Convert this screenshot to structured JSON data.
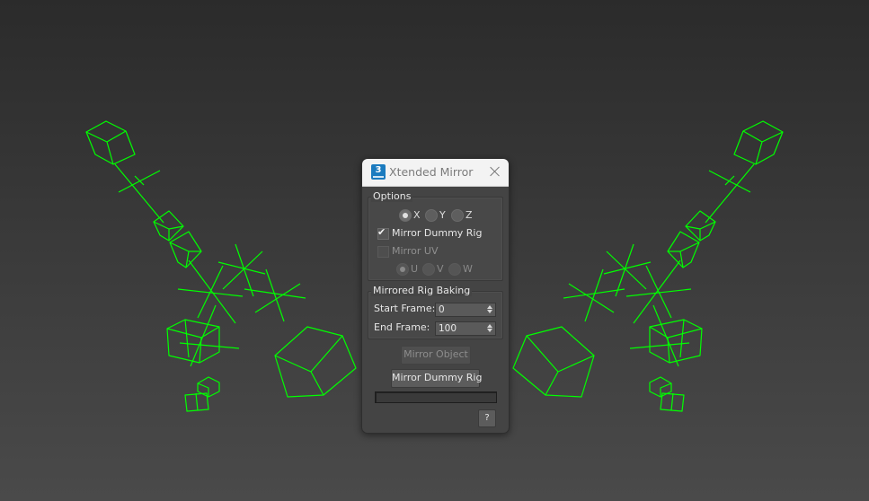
{
  "colors": {
    "wireframe": "#00ff00",
    "accent": "#1b7bbf"
  },
  "dialog": {
    "title": "Xtended Mirror",
    "icon": "3ds-max-app-icon",
    "options": {
      "label": "Options",
      "axis": [
        {
          "label": "X",
          "selected": true
        },
        {
          "label": "Y",
          "selected": false
        },
        {
          "label": "Z",
          "selected": false
        }
      ],
      "mirror_dummy_rig": {
        "label": "Mirror Dummy Rig",
        "checked": true
      },
      "mirror_uv": {
        "label": "Mirror UV",
        "checked": false,
        "enabled": false
      },
      "uv_axis": [
        {
          "label": "U",
          "selected": true
        },
        {
          "label": "V",
          "selected": false
        },
        {
          "label": "W",
          "selected": false
        }
      ]
    },
    "baking": {
      "label": "Mirrored Rig Baking",
      "start_frame": {
        "label": "Start Frame:",
        "value": "0"
      },
      "end_frame": {
        "label": "End Frame:",
        "value": "100"
      }
    },
    "buttons": {
      "mirror_object": {
        "label": "Mirror Object",
        "enabled": false
      },
      "mirror_dummy_rig": {
        "label": "Mirror Dummy Rig",
        "enabled": true
      },
      "help": {
        "label": "?"
      }
    },
    "progress": 0
  }
}
